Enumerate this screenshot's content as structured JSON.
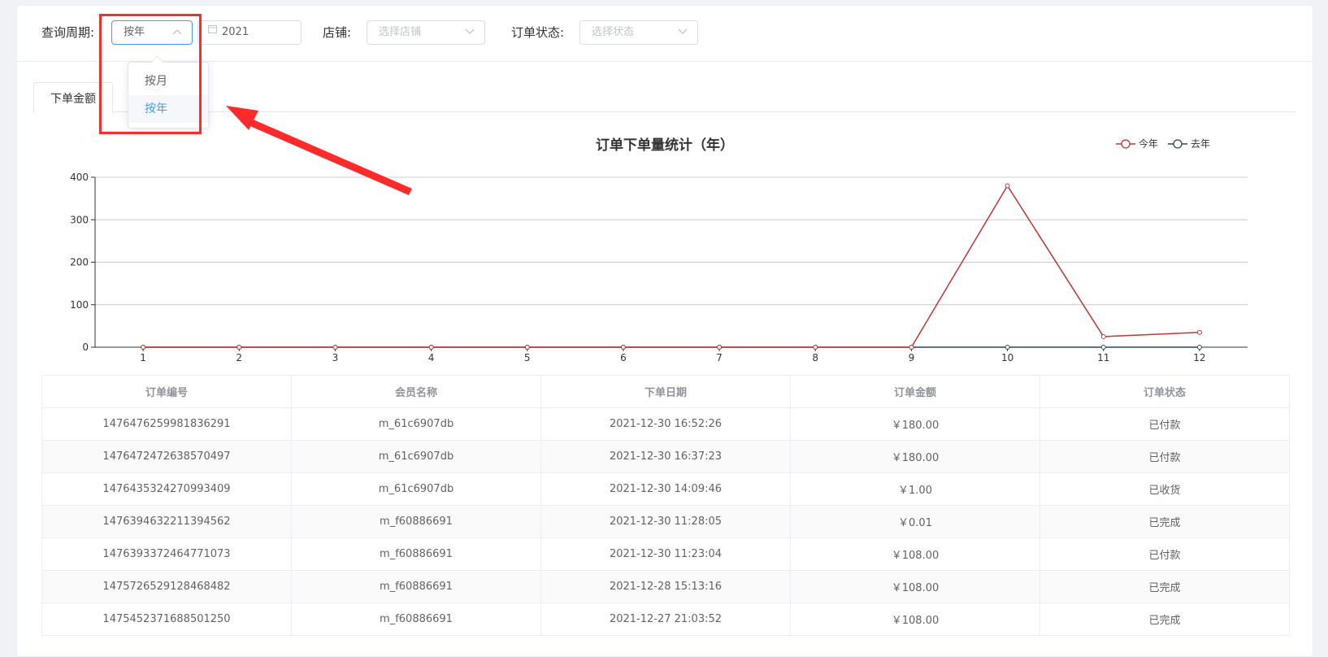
{
  "filters": {
    "period_label": "查询周期:",
    "period_value": "按年",
    "date_value": "2021",
    "store_label": "店铺:",
    "store_placeholder": "选择店铺",
    "status_label": "订单状态:",
    "status_placeholder": "选择状态"
  },
  "period_dropdown": {
    "options": [
      "按月",
      "按年"
    ],
    "selected": "按年"
  },
  "tabs": [
    "下单金额"
  ],
  "colors": {
    "accent": "#409eff",
    "this_year": "#c23531",
    "last_year": "#2f4554",
    "annotation": "#ff2b2b"
  },
  "chart_data": {
    "type": "line",
    "title": "订单下单量统计（年）",
    "categories": [
      "1",
      "2",
      "3",
      "4",
      "5",
      "6",
      "7",
      "8",
      "9",
      "10",
      "11",
      "12"
    ],
    "series": [
      {
        "name": "今年",
        "values": [
          0,
          0,
          0,
          0,
          0,
          0,
          0,
          0,
          0,
          380,
          25,
          35
        ]
      },
      {
        "name": "去年",
        "values": [
          0,
          0,
          0,
          0,
          0,
          0,
          0,
          0,
          0,
          0,
          0,
          0
        ]
      }
    ],
    "ylim": [
      0,
      400
    ],
    "yticks": [
      0,
      100,
      200,
      300,
      400
    ],
    "grid": true,
    "legend": "top-right"
  },
  "table": {
    "headers": [
      "订单编号",
      "会员名称",
      "下单日期",
      "订单金额",
      "订单状态"
    ],
    "rows": [
      [
        "1476476259981836291",
        "m_61c6907db",
        "2021-12-30 16:52:26",
        "￥180.00",
        "已付款"
      ],
      [
        "1476472472638570497",
        "m_61c6907db",
        "2021-12-30 16:37:23",
        "￥180.00",
        "已付款"
      ],
      [
        "1476435324270993409",
        "m_61c6907db",
        "2021-12-30 14:09:46",
        "￥1.00",
        "已收货"
      ],
      [
        "1476394632211394562",
        "m_f60886691",
        "2021-12-30 11:28:05",
        "￥0.01",
        "已完成"
      ],
      [
        "1476393372464771073",
        "m_f60886691",
        "2021-12-30 11:23:04",
        "￥108.00",
        "已付款"
      ],
      [
        "1475726529128468482",
        "m_f60886691",
        "2021-12-28 15:13:16",
        "￥108.00",
        "已完成"
      ],
      [
        "1475452371688501250",
        "m_f60886691",
        "2021-12-27 21:03:52",
        "￥108.00",
        "已完成"
      ]
    ]
  }
}
